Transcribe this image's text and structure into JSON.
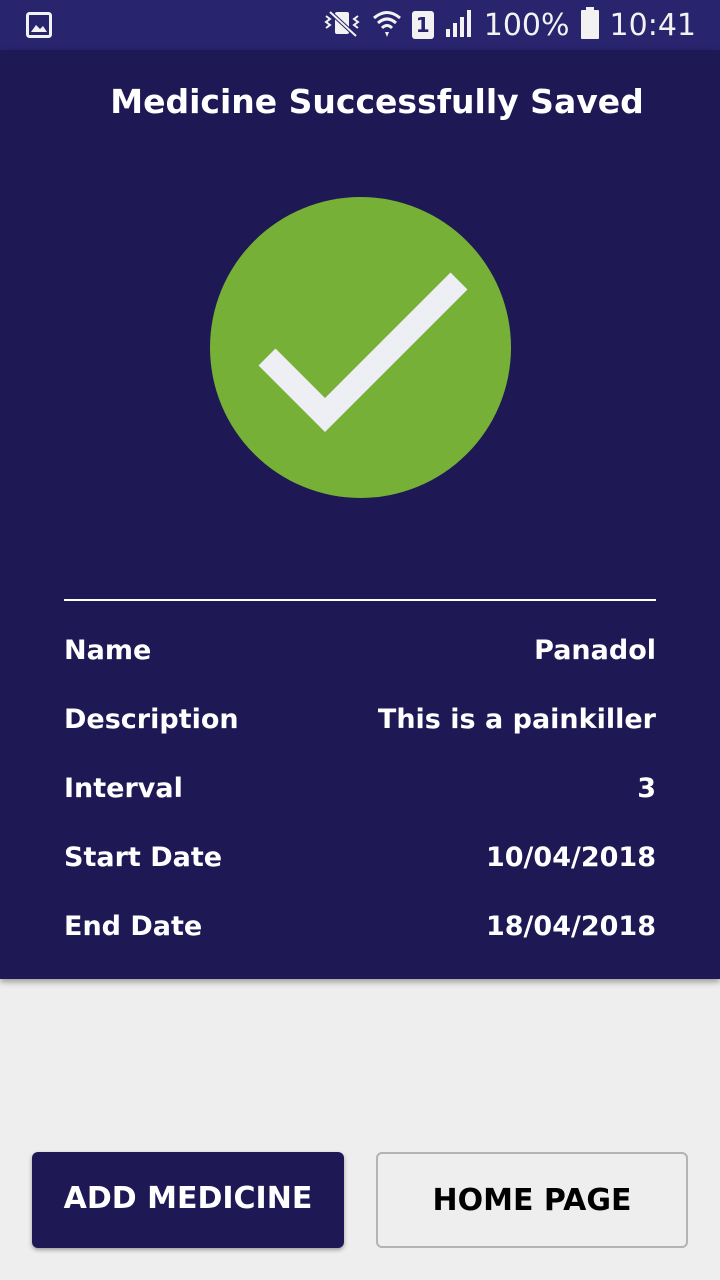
{
  "status_bar": {
    "battery_text": "100%",
    "time": "10:41",
    "sim_label": "1",
    "icons": [
      "gallery-icon",
      "vibrate-icon",
      "wifi-icon",
      "sim-icon",
      "signal-icon",
      "battery-icon"
    ]
  },
  "header": {
    "title": "Medicine Successfully Saved"
  },
  "success_icon": {
    "name": "checkmark-icon",
    "circle_color": "#76b036",
    "check_color": "#eeeef5"
  },
  "details": [
    {
      "label": "Name",
      "value": "Panadol"
    },
    {
      "label": "Description",
      "value": "This is a painkiller"
    },
    {
      "label": "Interval",
      "value": "3"
    },
    {
      "label": "Start Date",
      "value": "10/04/2018"
    },
    {
      "label": "End Date",
      "value": "18/04/2018"
    }
  ],
  "buttons": {
    "add_medicine": "ADD MEDICINE",
    "home_page": "HOME PAGE"
  },
  "colors": {
    "panel": "#1e1854",
    "status_bar": "#28246e",
    "background": "#eeeeee"
  }
}
